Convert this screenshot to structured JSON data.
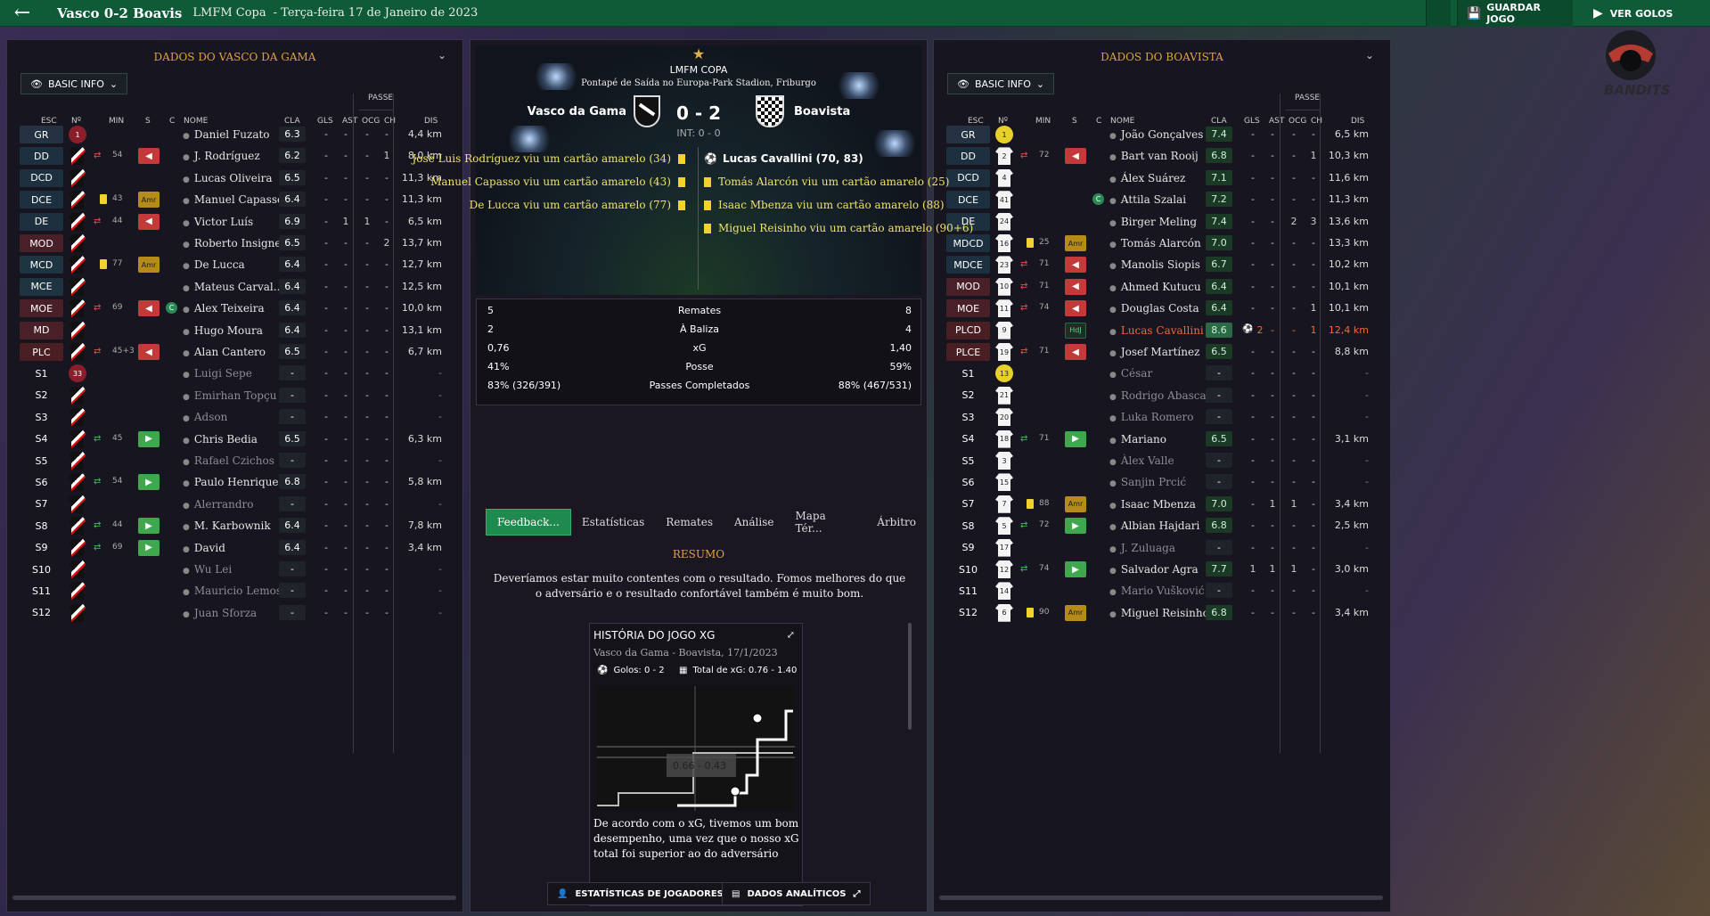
{
  "topbar": {
    "title": "Vasco  0-2 Boavis",
    "competition": "LMFM Copa",
    "date": "- Terça-feira 17 de Janeiro de 2023",
    "save": "GUARDAR JOGO",
    "goals": "VER GOLOS"
  },
  "left": {
    "title": "DADOS DO VASCO DA GAMA",
    "basic": "BASIC INFO"
  },
  "right": {
    "title": "DADOS DO BOAVISTA",
    "basic": "BASIC INFO"
  },
  "headers": {
    "esc": "ESC",
    "no": "Nº",
    "min": "MIN",
    "s": "S",
    "c": "C",
    "nome": "NOME",
    "cla": "CLA",
    "gls": "GLS",
    "ast": "AST",
    "passe": "PASSE",
    "ocg": "OCG",
    "ch": "CH",
    "dis": "DIS"
  },
  "home_players": [
    {
      "pos": "GR",
      "num": "1",
      "name": "Daniel Fuzato",
      "cla": "6.3",
      "gls": "-",
      "ast": "-",
      "ocg": "-",
      "ch": "-",
      "dis": "4,4 km"
    },
    {
      "pos": "DD",
      "num": "",
      "min": "54",
      "sub": "off",
      "name": "J. Rodríguez",
      "cla": "6.2",
      "gls": "-",
      "ast": "-",
      "ocg": "-",
      "ch": "1",
      "dis": "8,0 km"
    },
    {
      "pos": "DCD",
      "num": "",
      "name": "Lucas Oliveira",
      "cla": "6.5",
      "gls": "-",
      "ast": "-",
      "ocg": "-",
      "ch": "-",
      "dis": "11,3 km"
    },
    {
      "pos": "DCE",
      "num": "",
      "min": "43",
      "card": true,
      "amr": "Amr",
      "name": "Manuel Capasso",
      "cla": "6.4",
      "gls": "-",
      "ast": "-",
      "ocg": "-",
      "ch": "-",
      "dis": "11,3 km"
    },
    {
      "pos": "DE",
      "num": "",
      "min": "44",
      "sub": "off",
      "name": "Victor Luís",
      "cla": "6.9",
      "gls": "-",
      "ast": "1",
      "ocg": "1",
      "ch": "-",
      "dis": "6,5 km"
    },
    {
      "pos": "MOD",
      "num": "",
      "name": "Roberto Insigne",
      "cla": "6.5",
      "gls": "-",
      "ast": "-",
      "ocg": "-",
      "ch": "2",
      "dis": "13,7 km"
    },
    {
      "pos": "MCD",
      "num": "",
      "min": "77",
      "card": true,
      "amr": "Amr",
      "name": "De Lucca",
      "cla": "6.4",
      "gls": "-",
      "ast": "-",
      "ocg": "-",
      "ch": "-",
      "dis": "12,7 km"
    },
    {
      "pos": "MCE",
      "num": "",
      "name": "Mateus Carval...",
      "cla": "6.4",
      "gls": "-",
      "ast": "-",
      "ocg": "-",
      "ch": "-",
      "dis": "12,5 km"
    },
    {
      "pos": "MOE",
      "num": "",
      "min": "69",
      "sub": "off",
      "cap": "C",
      "name": "Alex Teixeira",
      "cla": "6.4",
      "gls": "-",
      "ast": "-",
      "ocg": "-",
      "ch": "-",
      "dis": "10,0 km"
    },
    {
      "pos": "MD",
      "num": "",
      "name": "Hugo Moura",
      "cla": "6.4",
      "gls": "-",
      "ast": "-",
      "ocg": "-",
      "ch": "-",
      "dis": "13,1 km"
    },
    {
      "pos": "PLC",
      "num": "",
      "min": "45+3",
      "sub": "off",
      "name": "Alan Cantero",
      "cla": "6.5",
      "gls": "-",
      "ast": "-",
      "ocg": "-",
      "ch": "-",
      "dis": "6,7 km"
    },
    {
      "pos": "S1",
      "num": "33",
      "name": "Luigi Sepe",
      "cla": "-",
      "gls": "-",
      "ast": "-",
      "ocg": "-",
      "ch": "-",
      "dis": "-"
    },
    {
      "pos": "S2",
      "num": "",
      "name": "Emirhan Topçu",
      "cla": "-",
      "gls": "-",
      "ast": "-",
      "ocg": "-",
      "ch": "-",
      "dis": "-"
    },
    {
      "pos": "S3",
      "num": "",
      "name": "Adson",
      "cla": "-",
      "gls": "-",
      "ast": "-",
      "ocg": "-",
      "ch": "-",
      "dis": "-"
    },
    {
      "pos": "S4",
      "num": "",
      "min": "45",
      "sub": "on",
      "name": "Chris Bedia",
      "cla": "6.5",
      "gls": "-",
      "ast": "-",
      "ocg": "-",
      "ch": "-",
      "dis": "6,3 km"
    },
    {
      "pos": "S5",
      "num": "",
      "name": "Rafael Czichos",
      "cla": "-",
      "gls": "-",
      "ast": "-",
      "ocg": "-",
      "ch": "-",
      "dis": "-"
    },
    {
      "pos": "S6",
      "num": "",
      "min": "54",
      "sub": "on",
      "name": "Paulo Henrique",
      "cla": "6.8",
      "gls": "-",
      "ast": "-",
      "ocg": "-",
      "ch": "-",
      "dis": "5,8 km"
    },
    {
      "pos": "S7",
      "num": "",
      "name": "Alerrandro",
      "cla": "-",
      "gls": "-",
      "ast": "-",
      "ocg": "-",
      "ch": "-",
      "dis": "-"
    },
    {
      "pos": "S8",
      "num": "",
      "min": "44",
      "sub": "on",
      "name": "M. Karbownik",
      "cla": "6.4",
      "gls": "-",
      "ast": "-",
      "ocg": "-",
      "ch": "-",
      "dis": "7,8 km"
    },
    {
      "pos": "S9",
      "num": "",
      "min": "69",
      "sub": "on",
      "name": "David",
      "cla": "6.4",
      "gls": "-",
      "ast": "-",
      "ocg": "-",
      "ch": "-",
      "dis": "3,4 km"
    },
    {
      "pos": "S10",
      "num": "",
      "name": "Wu Lei",
      "cla": "-",
      "gls": "-",
      "ast": "-",
      "ocg": "-",
      "ch": "-",
      "dis": "-"
    },
    {
      "pos": "S11",
      "num": "",
      "name": "Mauricio Lemos",
      "cla": "-",
      "gls": "-",
      "ast": "-",
      "ocg": "-",
      "ch": "-",
      "dis": "-"
    },
    {
      "pos": "S12",
      "num": "",
      "name": "Juan Sforza",
      "cla": "-",
      "gls": "-",
      "ast": "-",
      "ocg": "-",
      "ch": "-",
      "dis": "-"
    }
  ],
  "away_players": [
    {
      "pos": "GR",
      "num": "1",
      "name": "João Gonçalves",
      "cla": "7.4",
      "gls": "-",
      "ast": "-",
      "ocg": "-",
      "ch": "-",
      "dis": "6,5 km"
    },
    {
      "pos": "DD",
      "num": "2",
      "min": "72",
      "sub": "off",
      "name": "Bart van Rooij",
      "cla": "6.8",
      "gls": "-",
      "ast": "-",
      "ocg": "-",
      "ch": "1",
      "dis": "10,3 km"
    },
    {
      "pos": "DCD",
      "num": "4",
      "name": "Álex Suárez",
      "cla": "7.1",
      "gls": "-",
      "ast": "-",
      "ocg": "-",
      "ch": "-",
      "dis": "11,6 km"
    },
    {
      "pos": "DCE",
      "num": "41",
      "cap": "C",
      "name": "Attila Szalai",
      "cla": "7.2",
      "gls": "-",
      "ast": "-",
      "ocg": "-",
      "ch": "-",
      "dis": "11,3 km"
    },
    {
      "pos": "DE",
      "num": "24",
      "name": "Birger Meling",
      "cla": "7.4",
      "gls": "-",
      "ast": "-",
      "ocg": "2",
      "ch": "3",
      "dis": "13,6 km"
    },
    {
      "pos": "MDCD",
      "num": "16",
      "min": "25",
      "card": true,
      "amr": "Amr",
      "name": "Tomás Alarcón",
      "cla": "7.0",
      "gls": "-",
      "ast": "-",
      "ocg": "-",
      "ch": "-",
      "dis": "13,3 km"
    },
    {
      "pos": "MDCE",
      "num": "23",
      "min": "71",
      "sub": "off",
      "name": "Manolis Siopis",
      "cla": "6.7",
      "gls": "-",
      "ast": "-",
      "ocg": "-",
      "ch": "-",
      "dis": "10,2 km"
    },
    {
      "pos": "MOD",
      "num": "10",
      "min": "71",
      "sub": "off",
      "name": "Ahmed Kutucu",
      "cla": "6.4",
      "gls": "-",
      "ast": "-",
      "ocg": "-",
      "ch": "-",
      "dis": "10,1 km"
    },
    {
      "pos": "MOE",
      "num": "11",
      "min": "74",
      "sub": "off",
      "name": "Douglas Costa",
      "cla": "6.4",
      "gls": "-",
      "ast": "-",
      "ocg": "-",
      "ch": "1",
      "dis": "10,1 km"
    },
    {
      "pos": "PLCD",
      "num": "9",
      "hdj": "HdJ",
      "name": "Lucas Cavallini",
      "cla": "8.6",
      "gls": "2",
      "ast": "-",
      "ocg": "-",
      "ch": "1",
      "dis": "12,4 km",
      "hl": true
    },
    {
      "pos": "PLCE",
      "num": "19",
      "min": "71",
      "sub": "off",
      "name": "Josef Martínez",
      "cla": "6.5",
      "gls": "-",
      "ast": "-",
      "ocg": "-",
      "ch": "-",
      "dis": "8,8 km"
    },
    {
      "pos": "S1",
      "num": "13",
      "name": "César",
      "cla": "-",
      "gls": "-",
      "ast": "-",
      "ocg": "-",
      "ch": "-",
      "dis": "-"
    },
    {
      "pos": "S2",
      "num": "21",
      "name": "Rodrigo Abascal",
      "cla": "-",
      "gls": "-",
      "ast": "-",
      "ocg": "-",
      "ch": "-",
      "dis": "-"
    },
    {
      "pos": "S3",
      "num": "20",
      "name": "Luka Romero",
      "cla": "-",
      "gls": "-",
      "ast": "-",
      "ocg": "-",
      "ch": "-",
      "dis": "-"
    },
    {
      "pos": "S4",
      "num": "18",
      "min": "71",
      "sub": "on",
      "name": "Mariano",
      "cla": "6.5",
      "gls": "-",
      "ast": "-",
      "ocg": "-",
      "ch": "-",
      "dis": "3,1 km"
    },
    {
      "pos": "S5",
      "num": "3",
      "name": "Àlex Valle",
      "cla": "-",
      "gls": "-",
      "ast": "-",
      "ocg": "-",
      "ch": "-",
      "dis": "-"
    },
    {
      "pos": "S6",
      "num": "15",
      "name": "Sanjin Prcić",
      "cla": "-",
      "gls": "-",
      "ast": "-",
      "ocg": "-",
      "ch": "-",
      "dis": "-"
    },
    {
      "pos": "S7",
      "num": "7",
      "min": "88",
      "card": true,
      "amr": "Amr",
      "name": "Isaac Mbenza",
      "cla": "7.0",
      "gls": "-",
      "ast": "1",
      "ocg": "1",
      "ch": "-",
      "dis": "3,4 km"
    },
    {
      "pos": "S8",
      "num": "5",
      "min": "72",
      "sub": "on",
      "name": "Albian Hajdari",
      "cla": "6.8",
      "gls": "-",
      "ast": "-",
      "ocg": "-",
      "ch": "-",
      "dis": "2,5 km"
    },
    {
      "pos": "S9",
      "num": "17",
      "name": "J. Zuluaga",
      "cla": "-",
      "gls": "-",
      "ast": "-",
      "ocg": "-",
      "ch": "-",
      "dis": "-"
    },
    {
      "pos": "S10",
      "num": "12",
      "min": "74",
      "sub": "on",
      "name": "Salvador Agra",
      "cla": "7.7",
      "gls": "1",
      "ast": "1",
      "ocg": "1",
      "ch": "-",
      "dis": "3,0 km"
    },
    {
      "pos": "S11",
      "num": "14",
      "name": "Mario Vušković",
      "cla": "-",
      "gls": "-",
      "ast": "-",
      "ocg": "-",
      "ch": "-",
      "dis": "-"
    },
    {
      "pos": "S12",
      "num": "6",
      "min": "90",
      "card": true,
      "amr": "Amr",
      "name": "Miguel Reisinho",
      "cla": "6.8",
      "gls": "-",
      "ast": "-",
      "ocg": "-",
      "ch": "-",
      "dis": "3,4 km"
    }
  ],
  "match": {
    "competition": "LMFM COPA",
    "venue": "Pontapé de Saída no Europa-Park Stadion, Friburgo",
    "home": "Vasco da Gama",
    "away": "Boavista",
    "score": "0 - 2",
    "int": "INT: 0 - 0",
    "home_events": [
      "José Luis Rodríguez viu um cartão amarelo (34)",
      "Manuel Capasso viu um cartão amarelo (43)",
      "De Lucca viu um cartão amarelo (77)"
    ],
    "away_events": [
      "Lucas Cavallini (70, 83)",
      "Tomás Alarcón viu um cartão amarelo (25)",
      "Isaac Mbenza viu um cartão amarelo (88)",
      "Miguel Reisinho viu um cartão amarelo (90+6)"
    ]
  },
  "stats": [
    {
      "h": "5",
      "label": "Remates",
      "a": "8"
    },
    {
      "h": "2",
      "label": "À Baliza",
      "a": "4"
    },
    {
      "h": "0,76",
      "label": "xG",
      "a": "1,40"
    },
    {
      "h": "41%",
      "label": "Posse",
      "a": "59%"
    },
    {
      "h": "83% (326/391)",
      "label": "Passes Completados",
      "a": "88% (467/531)"
    }
  ],
  "tabs": [
    "Feedback...",
    "Estatísticas",
    "Remates",
    "Análise",
    "Mapa Tér...",
    "Árbitro"
  ],
  "summary": {
    "title": "RESUMO",
    "text": "Deveríamos estar muito contentes com o resultado. Fomos melhores do que o adversário e o resultado confortável também é muito bom."
  },
  "xgcard": {
    "title": "HISTÓRIA DO JOGO XG",
    "sub": "Vasco da Gama - Boavista, 17/1/2023",
    "goals": "Golos: 0 - 2",
    "total": "Total de xG: 0.76 - 1.40",
    "tooltip": "0.66 - 0.43",
    "text": "De acordo com o xG, tivemos um bom desempenho, uma vez que o nosso xG total foi superior ao do adversário"
  },
  "bottom": {
    "players": "ESTATÍSTICAS DE JOGADORES",
    "analytics": "DADOS ANALÍTICOS"
  },
  "logo": "BANDITS"
}
